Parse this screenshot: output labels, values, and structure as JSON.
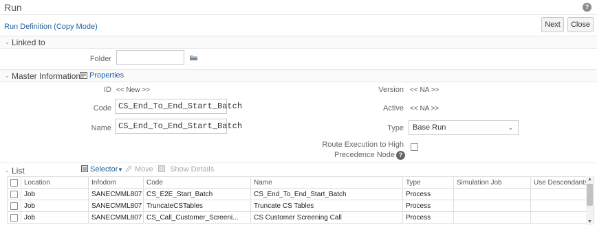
{
  "window": {
    "title": "Run",
    "help_icon_text": "?"
  },
  "header": {
    "subtitle": "Run Definition (Copy Mode)",
    "next_label": "Next",
    "close_label": "Close"
  },
  "linked_to": {
    "section_label": "Linked to",
    "folder_label": "Folder",
    "folder_value": ""
  },
  "master": {
    "section_label": "Master Information",
    "properties_label": "Properties",
    "id_label": "ID",
    "id_value": "<< New >>",
    "code_label": "Code",
    "code_value": "CS_End_To_End_Start_Batch",
    "name_label": "Name",
    "name_value": "CS_End_To_End_Start_Batch",
    "version_label": "Version",
    "version_value": "<< NA >>",
    "active_label": "Active",
    "active_value": "<< NA >>",
    "type_label": "Type",
    "type_value": "Base Run",
    "route_label_line1": "Route Execution to High",
    "route_label_line2": "Precedence Node",
    "route_help_text": "?"
  },
  "list": {
    "section_label": "List",
    "selector_label": "Selector",
    "move_label": "Move",
    "show_details_label": "Show Details",
    "columns": [
      "Location",
      "Infodom",
      "Code",
      "Name",
      "Type",
      "Simulation Job",
      "Use Descendants"
    ],
    "rows": [
      {
        "location": "Job",
        "infodom": "SANECMML807",
        "code": "CS_E2E_Start_Batch",
        "name": "CS_End_To_End_Start_Batch",
        "type": "Process",
        "simulation_job": "",
        "use_descendants": ""
      },
      {
        "location": "Job",
        "infodom": "SANECMML807",
        "code": "TruncateCSTables",
        "name": "Truncate CS Tables",
        "type": "Process",
        "simulation_job": "",
        "use_descendants": ""
      },
      {
        "location": "Job",
        "infodom": "SANECMML807",
        "code": "CS_Call_Customer_Screeni...",
        "name": "CS Customer Screening Call",
        "type": "Process",
        "simulation_job": "",
        "use_descendants": ""
      }
    ]
  },
  "colors": {
    "accent_link": "#1e5f9c",
    "border": "#c9c9c9",
    "scroll_thumb": "#c1c1c1"
  },
  "icons": [
    "help-icon",
    "folder-browse-icon",
    "properties-icon",
    "selector-icon",
    "move-icon",
    "show-details-icon",
    "chevron-down-icon"
  ]
}
